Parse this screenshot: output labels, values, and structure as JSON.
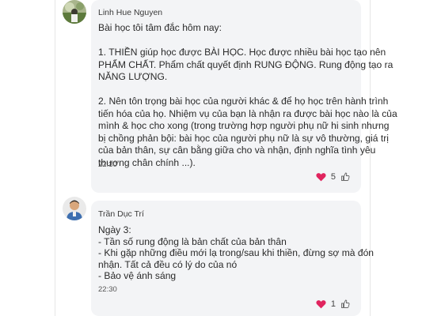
{
  "comments": [
    {
      "author": "Linh Hue Nguyen",
      "lines": [
        "Bài học tôi tâm đắc hôm nay:",
        "",
        "1. THIỀN giúp học được BÀI HỌC. Học được nhiều bài học tạo nên",
        "PHẨM CHẤT. Phẩm chất quyết định RUNG ĐỘNG. Rung động tạo ra",
        "NĂNG LƯỢNG.",
        "",
        "2. Nên tôn trọng bài học của người khác & để họ học trên hành trình",
        "tiến hóa của họ. Nhiệm vụ của bạn là nhận ra được bài học nào là của",
        "mình & học cho xong (trong trường hợp người phụ nữ hi sinh nhưng",
        "bị chồng phản bội: bài học của người phụ nữ là sự vô thường, giá trị",
        "của bản thân, sự cân bằng giữa cho và nhận, định nghĩa tình yêu",
        "thương chân chính ...)."
      ],
      "time": "22:30",
      "reaction_count": "5",
      "reaction_icon": "heart-icon",
      "like_icon": "thumbs-up-icon"
    },
    {
      "author": "Trần Dục Trí",
      "lines": [
        "Ngày 3:",
        "- Tần số rung động là bản chất của bản thân",
        "- Khi gặp những điều mới lạ trong/sau khi thiền, đừng sợ mà đón",
        "nhận. Tất cả đều có lý do của nó",
        "- Bảo vệ ánh sáng"
      ],
      "time": "22:30",
      "reaction_count": "1",
      "reaction_icon": "heart-icon",
      "like_icon": "thumbs-up-icon"
    }
  ],
  "colors": {
    "bubble": "#f3f4f6",
    "heart": "#e0245e",
    "text": "#2a2a2a"
  }
}
